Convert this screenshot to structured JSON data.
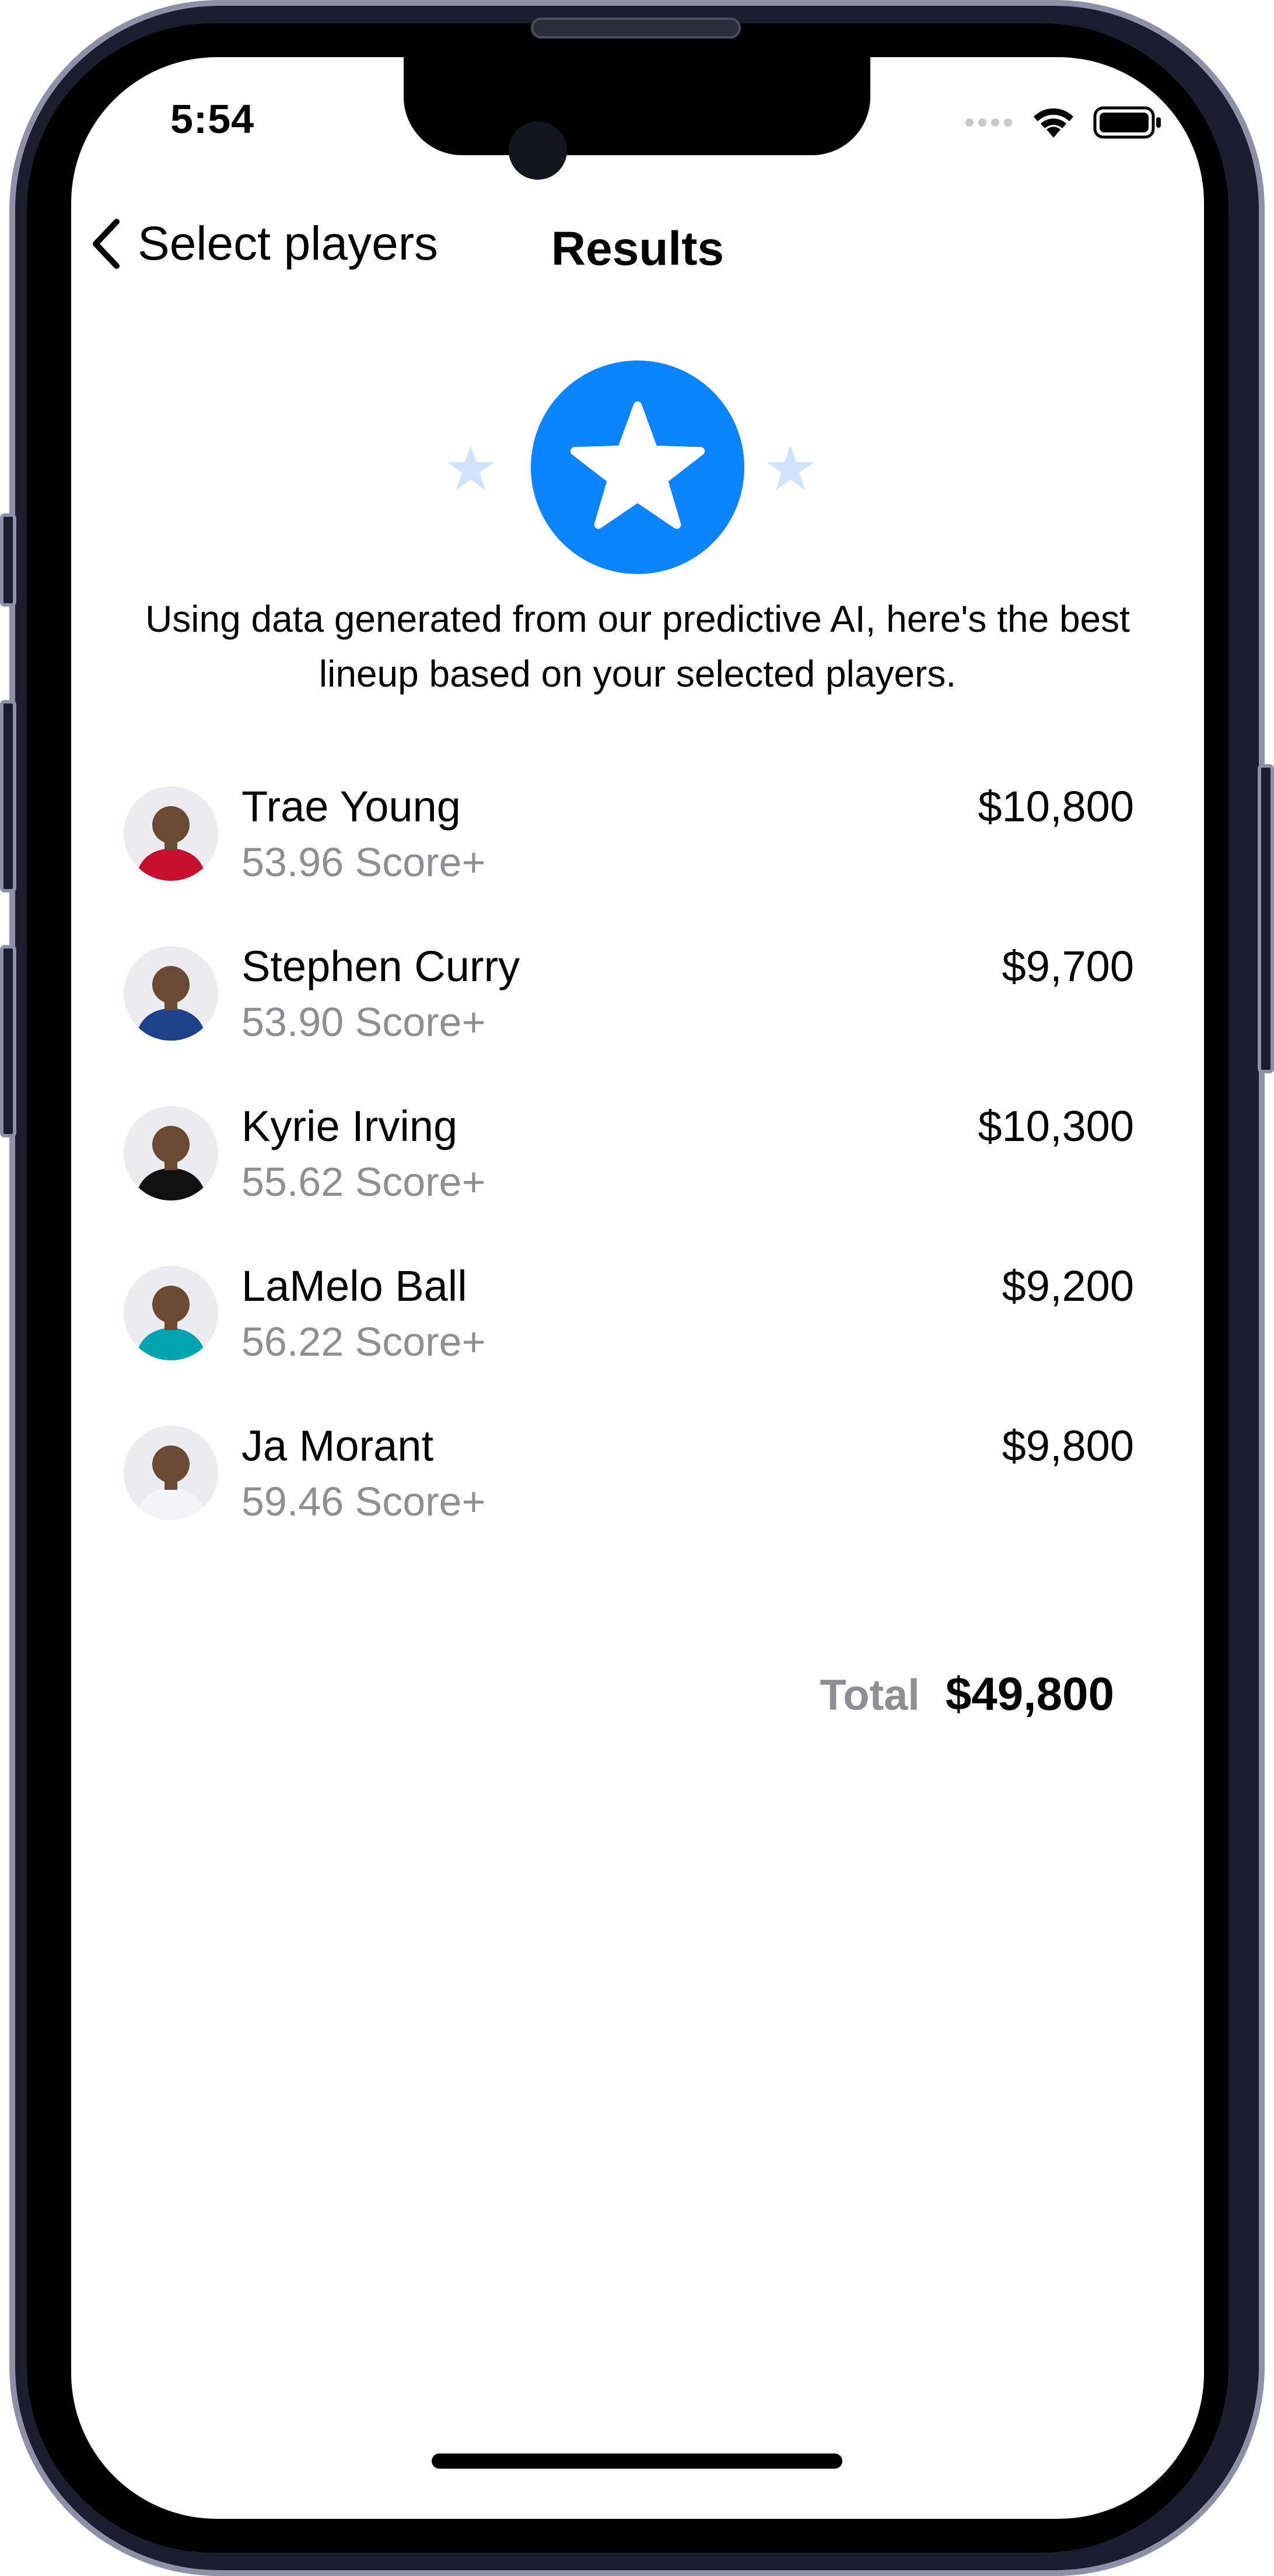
{
  "status_bar": {
    "time": "5:54",
    "signal_icon": "signal-dots-icon",
    "wifi_icon": "wifi-icon",
    "battery_icon": "battery-icon"
  },
  "nav": {
    "back_label": "Select players",
    "back_icon": "chevron-left-icon",
    "title": "Results"
  },
  "hero": {
    "icon": "star-icon",
    "accent_color": "#0a84ff",
    "sparkle_color": "#cfe3fb"
  },
  "intro_text": "Using data generated from our predictive AI, here's the best lineup based on your selected players.",
  "players": [
    {
      "name": "Trae Young",
      "score": "53.96 Score+",
      "price": "$10,800",
      "jersey_color": "#c8102e"
    },
    {
      "name": "Stephen Curry",
      "score": "53.90 Score+",
      "price": "$9,700",
      "jersey_color": "#1d428a"
    },
    {
      "name": "Kyrie Irving",
      "score": "55.62 Score+",
      "price": "$10,300",
      "jersey_color": "#111111"
    },
    {
      "name": "LaMelo Ball",
      "score": "56.22 Score+",
      "price": "$9,200",
      "jersey_color": "#00a3b0"
    },
    {
      "name": "Ja Morant",
      "score": "59.46 Score+",
      "price": "$9,800",
      "jersey_color": "#f4f4f6"
    }
  ],
  "total": {
    "label": "Total",
    "value": "$49,800"
  }
}
